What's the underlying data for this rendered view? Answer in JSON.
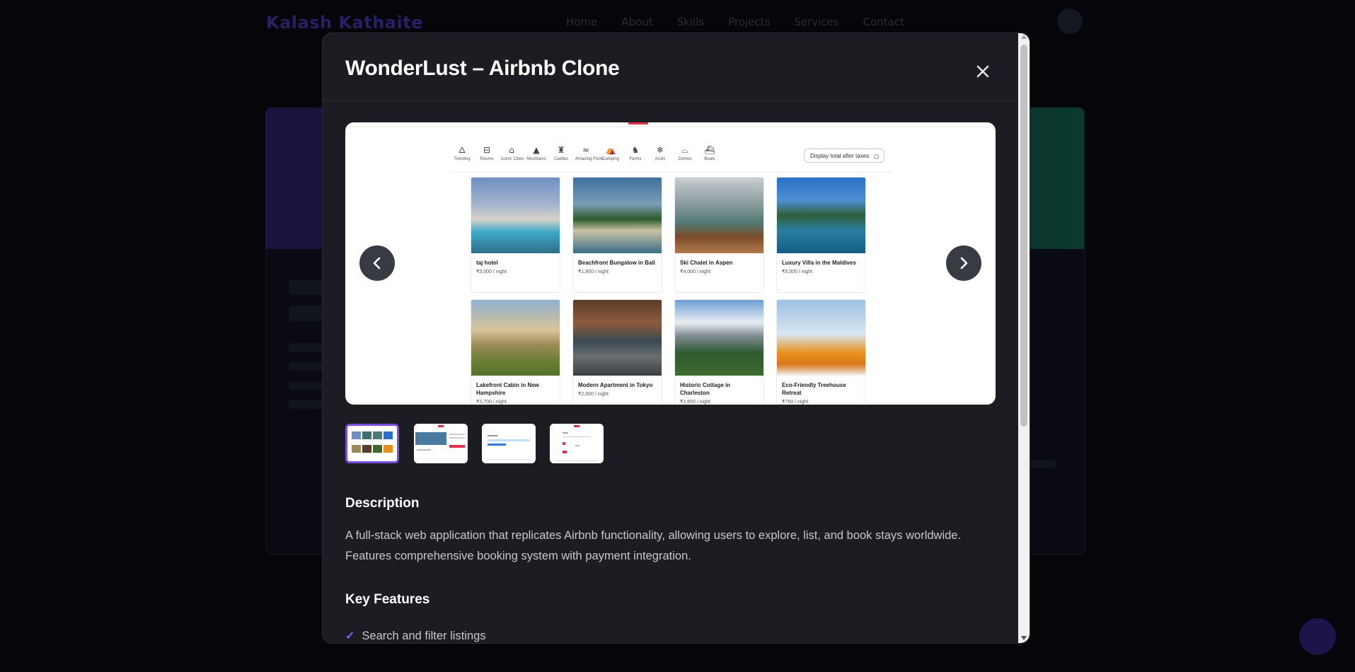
{
  "background": {
    "logo": "Kalash Kathaite",
    "nav_links": [
      "Home",
      "About",
      "Skills",
      "Projects",
      "Services",
      "Contact"
    ]
  },
  "modal": {
    "title": "WonderLust – Airbnb Clone",
    "close_icon": "close-icon",
    "carousel": {
      "prev_icon": "chevron-left-icon",
      "next_icon": "chevron-right-icon",
      "categories": [
        {
          "label": "Trending",
          "icon": "fire-icon"
        },
        {
          "label": "Rooms",
          "icon": "bed-icon"
        },
        {
          "label": "Iconic Cities",
          "icon": "city-icon"
        },
        {
          "label": "Mountains",
          "icon": "mountain-icon"
        },
        {
          "label": "Castles",
          "icon": "castle-icon"
        },
        {
          "label": "Amazing Pools",
          "icon": "pool-icon"
        },
        {
          "label": "Camping",
          "icon": "tent-icon"
        },
        {
          "label": "Farms",
          "icon": "cow-icon"
        },
        {
          "label": "Arctic",
          "icon": "snowflake-icon"
        },
        {
          "label": "Domes",
          "icon": "igloo-icon"
        },
        {
          "label": "Boats",
          "icon": "ship-icon"
        }
      ],
      "tax_toggle_label": "Display total after taxes",
      "listings": [
        {
          "title": "taj hotel",
          "price": "₹3,000 / night"
        },
        {
          "title": "Beachfront Bungalow in Bali",
          "price": "₹1,800 / night"
        },
        {
          "title": "Ski Chalet in Aspen",
          "price": "₹4,000 / night"
        },
        {
          "title": "Luxury Villa in the Maldives",
          "price": "₹6,000 / night"
        },
        {
          "title": "Lakefront Cabin in New Hampshire",
          "price": "₹3,700 / night"
        },
        {
          "title": "Modern Apartment in Tokyo",
          "price": "₹2,000 / night"
        },
        {
          "title": "Historic Cottage in Charleston",
          "price": "₹1,600 / night"
        },
        {
          "title": "Eco-Friendly Treehouse Retreat",
          "price": "₹750 / night"
        }
      ]
    },
    "thumbnails_count": 4,
    "active_thumbnail": 1,
    "description_heading": "Description",
    "description": "A full-stack web application that replicates Airbnb functionality, allowing users to explore, list, and book stays worldwide. Features comprehensive booking system with payment integration.",
    "features_heading": "Key Features",
    "features": [
      "Search and filter listings"
    ],
    "accent_color": "#7c4ddb"
  }
}
